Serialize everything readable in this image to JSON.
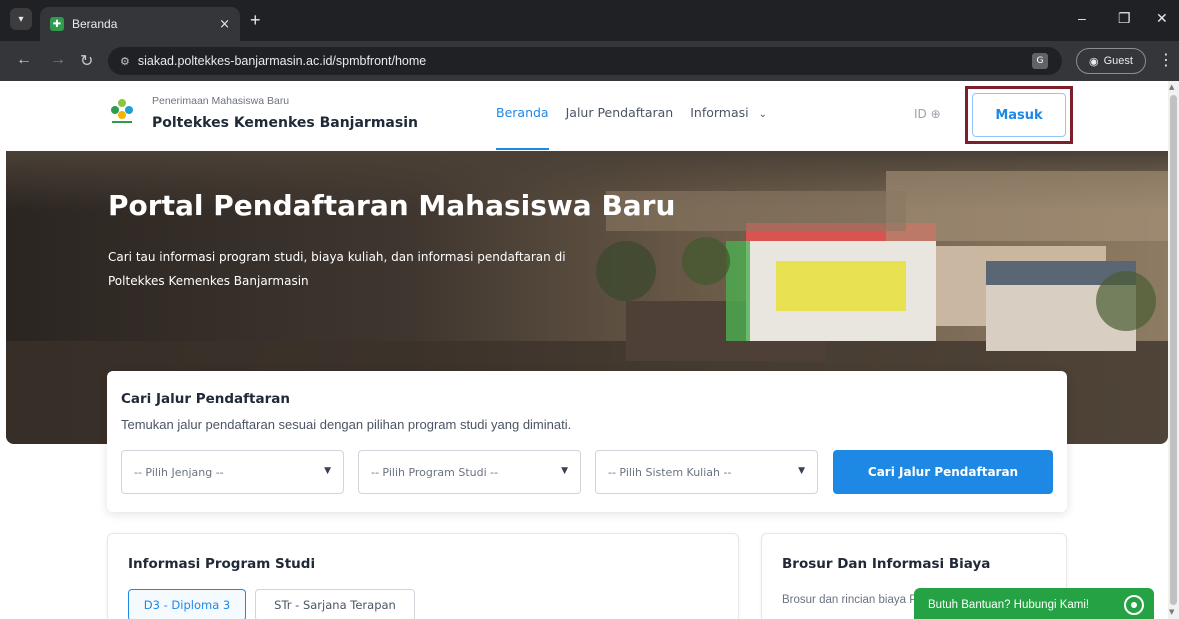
{
  "browser": {
    "tab_title": "Beranda",
    "tab_close": "×",
    "new_tab": "+",
    "url": "siakad.poltekkes-banjarmasin.ac.id/spmbfront/home",
    "profile_label": "Guest",
    "icons": [
      "tab-search-icon",
      "favicon",
      "close-icon",
      "plus-icon",
      "minimize-icon",
      "restore-icon",
      "window-close-icon",
      "back-icon",
      "forward-icon",
      "reload-icon",
      "site-info-icon",
      "translate-icon",
      "profile-icon",
      "kebab-menu-icon"
    ]
  },
  "header": {
    "brand_subtitle": "Penerimaan Mahasiswa Baru",
    "brand_title": "Poltekkes Kemenkes Banjarmasin",
    "nav": {
      "beranda": "Beranda",
      "jalur": "Jalur Pendaftaran",
      "informasi": "Informasi"
    },
    "lang": "ID",
    "login_label": "Masuk"
  },
  "hero": {
    "title": "Portal Pendaftaran Mahasiswa Baru",
    "description": "Cari tau informasi program studi, biaya kuliah, dan informasi pendaftaran di Poltekkes Kemenkes Banjarmasin"
  },
  "search": {
    "title": "Cari Jalur Pendaftaran",
    "description": "Temukan jalur pendaftaran sesuai dengan pilihan program studi yang diminati.",
    "select_jenjang": "-- Pilih Jenjang --",
    "select_prodi": "-- Pilih Program Studi --",
    "select_sistem": "-- Pilih Sistem Kuliah --",
    "button": "Cari Jalur Pendaftaran"
  },
  "prodi": {
    "title": "Informasi Program Studi",
    "tab_d3": "D3 - Diploma 3",
    "tab_str": "STr - Sarjana Terapan"
  },
  "brosur": {
    "title": "Brosur Dan Informasi Biaya",
    "text": "Brosur dan rincian biaya Poltekkes Kemenkes B"
  },
  "help": {
    "label": "Butuh Bantuan? Hubungi Kami!"
  },
  "colors": {
    "accent": "#1e88e5",
    "highlight_border": "#7d1f2b",
    "whatsapp": "#25a244",
    "chrome_dark": "#202124"
  }
}
